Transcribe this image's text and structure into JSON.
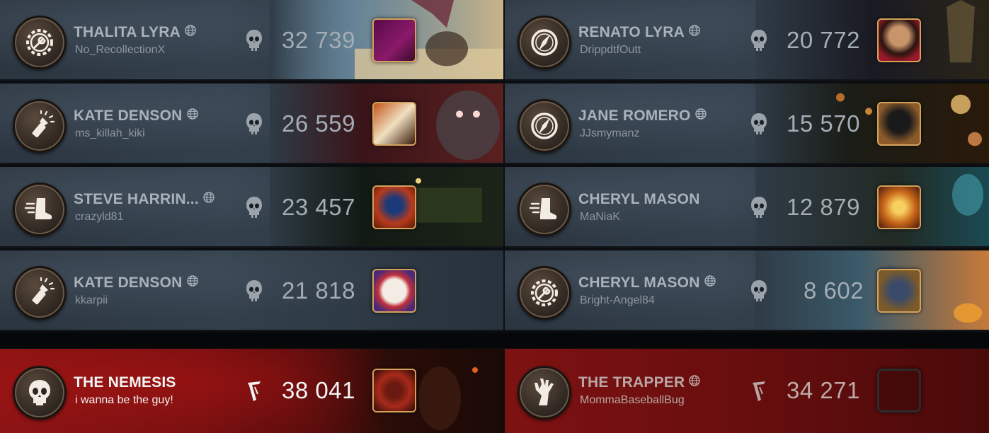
{
  "survivors_left": [
    {
      "character": "THALITA LYRA",
      "player": "No_RecollectionX",
      "score": "32 739",
      "badge_icon": "wrench-gear-icon",
      "portrait_color": "#8a1a6a"
    },
    {
      "character": "KATE DENSON",
      "player": "ms_killah_kiki",
      "score": "26 559",
      "badge_icon": "flashlight-icon",
      "portrait_color": "#c2541a"
    },
    {
      "character": "STEVE HARRIN...",
      "player": "crazyld81",
      "score": "23 457",
      "badge_icon": "running-boot-icon",
      "portrait_color": "#b83a1c"
    },
    {
      "character": "KATE DENSON",
      "player": "kkarpii",
      "score": "21 818",
      "badge_icon": "flashlight-icon",
      "portrait_color": "#4a2a78"
    }
  ],
  "survivors_right": [
    {
      "character": "RENATO LYRA",
      "player": "DrippdtfOutt",
      "score": "20 772",
      "badge_icon": "compass-icon",
      "portrait_color": "#9a1a2a"
    },
    {
      "character": "JANE ROMERO",
      "player": "JJsmymanz",
      "score": "15 570",
      "badge_icon": "compass-icon",
      "portrait_color": "#8a5a2a"
    },
    {
      "character": "CHERYL MASON",
      "player": "MaNiaK",
      "score": "12 879",
      "badge_icon": "running-boot-icon",
      "portrait_color": "#c8661a"
    },
    {
      "character": "CHERYL MASON",
      "player": "Bright-Angel84",
      "score": "8 602",
      "badge_icon": "wrench-gear-icon",
      "portrait_color": "#7a5a2a"
    }
  ],
  "killers": [
    {
      "character": "THE NEMESIS",
      "player": "i wanna be the guy!",
      "score": "38 041",
      "badge_icon": "skull-badge-icon",
      "portrait_color": "#a82a1a"
    },
    {
      "character": "THE TRAPPER",
      "player": "MommaBaseballBug",
      "score": "34 271",
      "badge_icon": "claw-hand-icon",
      "portrait_color": ""
    }
  ],
  "colors": {
    "survivor_card": "#2f3b46",
    "killer_card": "#8d1414",
    "portrait_border": "#d3a15c"
  }
}
